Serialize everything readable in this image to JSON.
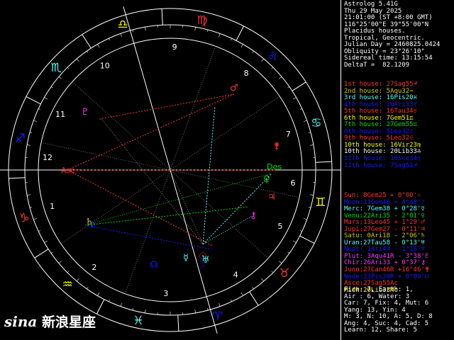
{
  "header": {
    "lines": [
      "Astrolog 5.41G",
      "Thu 29 May 2025",
      "21:01:00 (ST +8:00 GMT)",
      "116°25'00\"E 39°55'00\"N",
      "Placidus houses.",
      "Tropical, Geocentric.",
      "Julian Day = 2460825.0424",
      "Obliquity = 23°26'10\"",
      "Sidereal time: 13:15:54",
      "DeltaT =  82.1209"
    ]
  },
  "houses": [
    {
      "label": "1st house:",
      "value": "27Sag55",
      "color": "#ff3333",
      "glyph": "♐"
    },
    {
      "label": "2nd house:",
      "value": "5Aqu32",
      "color": "#c9c900",
      "glyph": "♒"
    },
    {
      "label": "3rd house:",
      "value": "16Pis20",
      "color": "#55ffff",
      "glyph": "♓"
    },
    {
      "label": "4th house:",
      "value": "20Ari33",
      "color": "#1a1aff",
      "glyph": "♈"
    },
    {
      "label": "5th house:",
      "value": "16Tau34",
      "color": "#ff3333",
      "glyph": "♉"
    },
    {
      "label": "6th house:",
      "value": "7Gem51",
      "color": "#ffff00",
      "glyph": "♊"
    },
    {
      "label": "7th house:",
      "value": "27Gem55",
      "color": "#00e000",
      "glyph": "♊"
    },
    {
      "label": "8th house:",
      "value": "5Leo32",
      "color": "#1a1aff",
      "glyph": "♌"
    },
    {
      "label": "9th house:",
      "value": "5Leo32",
      "color": "#ff3333",
      "glyph": "♌"
    },
    {
      "label": "10th house:",
      "value": "16Vir23",
      "color": "#ffff00",
      "glyph": "♍"
    },
    {
      "label": "10th house:",
      "value": "20Lib33",
      "color": "#ffffff",
      "glyph": "♎"
    },
    {
      "label": "11th house:",
      "value": "16Sco34",
      "color": "#1a1aff",
      "glyph": "♏"
    },
    {
      "label": "12th house:",
      "value": "7Sag51",
      "color": "#1a1aff",
      "glyph": "♐"
    }
  ],
  "planets": [
    {
      "label": " Sun:",
      "value": " 8Gem25",
      "lat": " + 0°00'",
      "color": "#ff3333",
      "glyph": "☉"
    },
    {
      "label": "Moon:",
      "value": "11Gem46",
      "lat": " + 4°48'",
      "color": "#1a1aff",
      "glyph": "☽"
    },
    {
      "label": "Merc:",
      "value": " 7Gem38",
      "lat": " + 0°28'",
      "color": "#55ffff",
      "glyph": "☿"
    },
    {
      "label": "Venu:",
      "value": "22Ari35",
      "lat": " - 2°01'",
      "color": "#00e000",
      "glyph": "♀"
    },
    {
      "label": "Mars:",
      "value": "13Leo45",
      "lat": " + 1°29'",
      "color": "#ff3333",
      "glyph": "♂"
    },
    {
      "label": "Jupi:",
      "value": "27Gem27",
      "lat": " - 0°11'",
      "color": "#ff3333",
      "glyph": "♃"
    },
    {
      "label": "Satu:",
      "value": " 0Ari18",
      "lat": " - 2°06'",
      "color": "#c9c900",
      "glyph": "♄"
    },
    {
      "label": "Uran:",
      "value": "27Tau58",
      "lat": " - 0°13'",
      "color": "#55ffff",
      "glyph": "♅"
    },
    {
      "label": "Nept:",
      "value": " 1Ari49",
      "lat": " - 1°18'",
      "color": "#1a1aff",
      "glyph": "♆"
    },
    {
      "label": "Plut:",
      "value": " 3Aqu41R",
      "lat": " - 3°38'",
      "color": "#ff33ff",
      "glyph": "♇"
    },
    {
      "label": "Chir:",
      "value": "26Ari33",
      "lat": " + 0°37'",
      "color": "#ff33ff",
      "glyph": "⚷"
    },
    {
      "label": "Juno:",
      "value": "27Can46R",
      "lat": " +16°46'",
      "color": "#ff3333",
      "glyph": "⚵"
    },
    {
      "label": "Node:",
      "value": "23Pis20R",
      "lat": " + 0°00'",
      "color": "#1a1aff",
      "glyph": "☊"
    },
    {
      "label": "Asce:",
      "value": "27Sag55",
      "lat": "",
      "color": "#ff3333",
      "glyph": "Ac"
    },
    {
      "label": "Midh:",
      "value": "20Lib33",
      "lat": "",
      "color": "#ffff00",
      "glyph": "Mc"
    }
  ],
  "stats": [
    "Fire: 7, Earth: 1,",
    "Air : 6, Water: 3",
    "Car: 7, Fix: 4, Mut: 6",
    "Yang: 13, Yin: 4",
    "M: 3, N: 10, A: 5, D: 8",
    "Ang: 4, Suc: 4, Cad: 5",
    "Learn: 12, Share: 5"
  ],
  "wheel": {
    "house_numbers": [
      "1",
      "2",
      "3",
      "4",
      "5",
      "6",
      "7",
      "8",
      "9",
      "10",
      "11",
      "12"
    ],
    "axis_labels": {
      "asc": "Asc",
      "des": "Des"
    },
    "signs": [
      {
        "glyph": "♑",
        "color": "#ff3333"
      },
      {
        "glyph": "♒",
        "color": "#ffff00"
      },
      {
        "glyph": "♓",
        "color": "#55ffff"
      },
      {
        "glyph": "♈",
        "color": "#1a1aff"
      },
      {
        "glyph": "♉",
        "color": "#ff3333"
      },
      {
        "glyph": "♊",
        "color": "#ffff00"
      },
      {
        "glyph": "♋",
        "color": "#55ffff"
      },
      {
        "glyph": "♌",
        "color": "#1a1aff"
      },
      {
        "glyph": "♍",
        "color": "#ff3333"
      },
      {
        "glyph": "♎",
        "color": "#ffff00"
      },
      {
        "glyph": "♏",
        "color": "#55ffff"
      },
      {
        "glyph": "♐",
        "color": "#1a1aff"
      }
    ]
  },
  "watermark": {
    "brand": "sina",
    "text": "新浪星座"
  }
}
